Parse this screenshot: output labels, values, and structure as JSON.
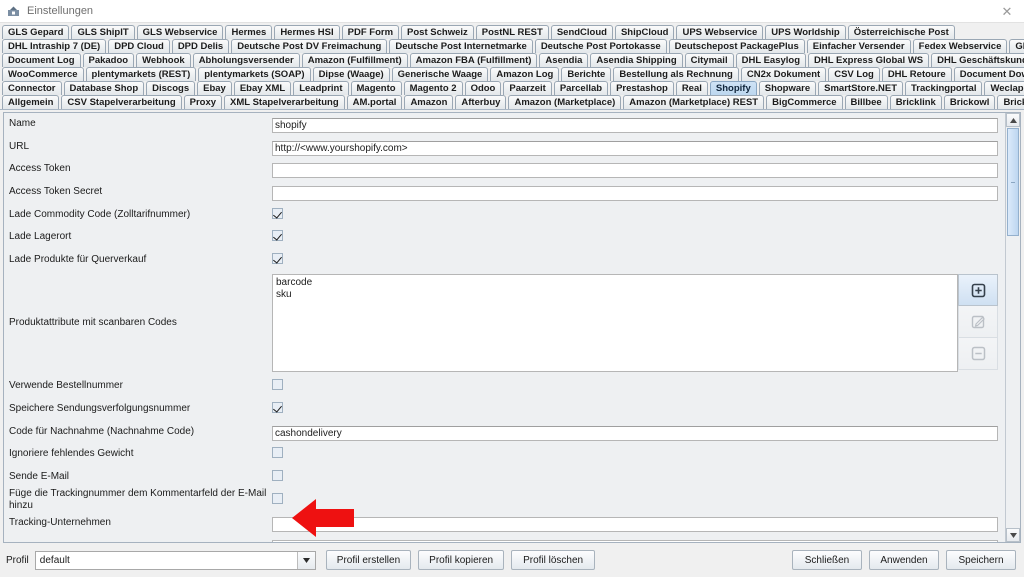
{
  "window": {
    "title": "Einstellungen",
    "app_icon": "settings-icon",
    "close_icon": "close-icon"
  },
  "tabs": {
    "selected": "Shopify",
    "rows": [
      [
        "GLS Gepard",
        "GLS ShipIT",
        "GLS Webservice",
        "Hermes",
        "Hermes HSI",
        "PDF Form",
        "Post Schweiz",
        "PostNL REST",
        "SendCloud",
        "ShipCloud",
        "UPS Webservice",
        "UPS Worldship",
        "Österreichische Post"
      ],
      [
        "DHL Intraship 7 (DE)",
        "DPD Cloud",
        "DPD Delis",
        "Deutsche Post DV Freimachung",
        "Deutsche Post Internetmarke",
        "Deutsche Post Portokasse",
        "Deutschepost PackagePlus",
        "Einfacher Versender",
        "Fedex Webservice",
        "GEL Express"
      ],
      [
        "Document Log",
        "Pakadoo",
        "Webhook",
        "Abholungsversender",
        "Amazon (Fulfillment)",
        "Amazon FBA (Fulfillment)",
        "Asendia",
        "Asendia Shipping",
        "Citymail",
        "DHL Easylog",
        "DHL Express Global WS",
        "DHL Geschäftskundenversand"
      ],
      [
        "WooCommerce",
        "plentymarkets (REST)",
        "plentymarkets (SOAP)",
        "Dipse (Waage)",
        "Generische Waage",
        "Amazon Log",
        "Berichte",
        "Bestellung als Rechnung",
        "CN2x Dokument",
        "CSV Log",
        "DHL Retoure",
        "Document Downloader"
      ],
      [
        "Connector",
        "Database Shop",
        "Discogs",
        "Ebay",
        "Ebay XML",
        "Leadprint",
        "Magento",
        "Magento 2",
        "Odoo",
        "Paarzeit",
        "Parcellab",
        "Prestashop",
        "Real",
        "Shopify",
        "Shopware",
        "SmartStore.NET",
        "Trackingportal",
        "Weclapp"
      ],
      [
        "Allgemein",
        "CSV Stapelverarbeitung",
        "Proxy",
        "XML Stapelverarbeitung",
        "AM.portal",
        "Amazon",
        "Afterbuy",
        "Amazon (Marketplace)",
        "Amazon (Marketplace) REST",
        "BigCommerce",
        "Billbee",
        "Bricklink",
        "Brickowl",
        "Brickscout"
      ]
    ]
  },
  "form": {
    "fields": [
      {
        "label": "Name",
        "type": "text",
        "value": "shopify"
      },
      {
        "label": "URL",
        "type": "text",
        "value": "http://<www.yourshopify.com>"
      },
      {
        "label": "Access Token",
        "type": "text",
        "value": ""
      },
      {
        "label": "Access Token Secret",
        "type": "text",
        "value": ""
      },
      {
        "label": "Lade Commodity Code (Zolltarifnummer)",
        "type": "checkbox",
        "checked": true
      },
      {
        "label": "Lade Lagerort",
        "type": "checkbox",
        "checked": true
      },
      {
        "label": "Lade Produkte für Querverkauf",
        "type": "checkbox",
        "checked": true
      },
      {
        "label": "Produktattribute mit scanbaren Codes",
        "type": "list",
        "items": [
          "barcode",
          "sku"
        ]
      },
      {
        "label": "Verwende Bestellnummer",
        "type": "checkbox",
        "checked": false
      },
      {
        "label": "Speichere Sendungsverfolgungsnummer",
        "type": "checkbox",
        "checked": true
      },
      {
        "label": "Code für Nachnahme (Nachnahme Code)",
        "type": "text",
        "value": "cashondelivery"
      },
      {
        "label": "Ignoriere fehlendes Gewicht",
        "type": "checkbox",
        "checked": false
      },
      {
        "label": "Sende E-Mail",
        "type": "checkbox",
        "checked": false
      },
      {
        "label": "Füge die Trackingnummer dem Kommentarfeld der E-Mail hinzu",
        "type": "checkbox",
        "checked": false
      },
      {
        "label": "Tracking-Unternehmen",
        "type": "text",
        "value": ""
      },
      {
        "label": "",
        "type": "text",
        "value": ""
      }
    ],
    "list_buttons": [
      {
        "icon": "add-icon",
        "enabled": true
      },
      {
        "icon": "edit-icon",
        "enabled": false
      },
      {
        "icon": "remove-icon",
        "enabled": false
      }
    ]
  },
  "bottom": {
    "profile_label": "Profil",
    "profile_value": "default",
    "dropdown_icon": "chevron-down-icon",
    "left_buttons": [
      "Profil erstellen",
      "Profil kopieren",
      "Profil löschen"
    ],
    "right_buttons": [
      "Schließen",
      "Anwenden",
      "Speichern"
    ]
  },
  "annotation": {
    "type": "arrow-left",
    "color": "#ee1111",
    "points_at": "Speichere Sendungsverfolgungsnummer"
  }
}
